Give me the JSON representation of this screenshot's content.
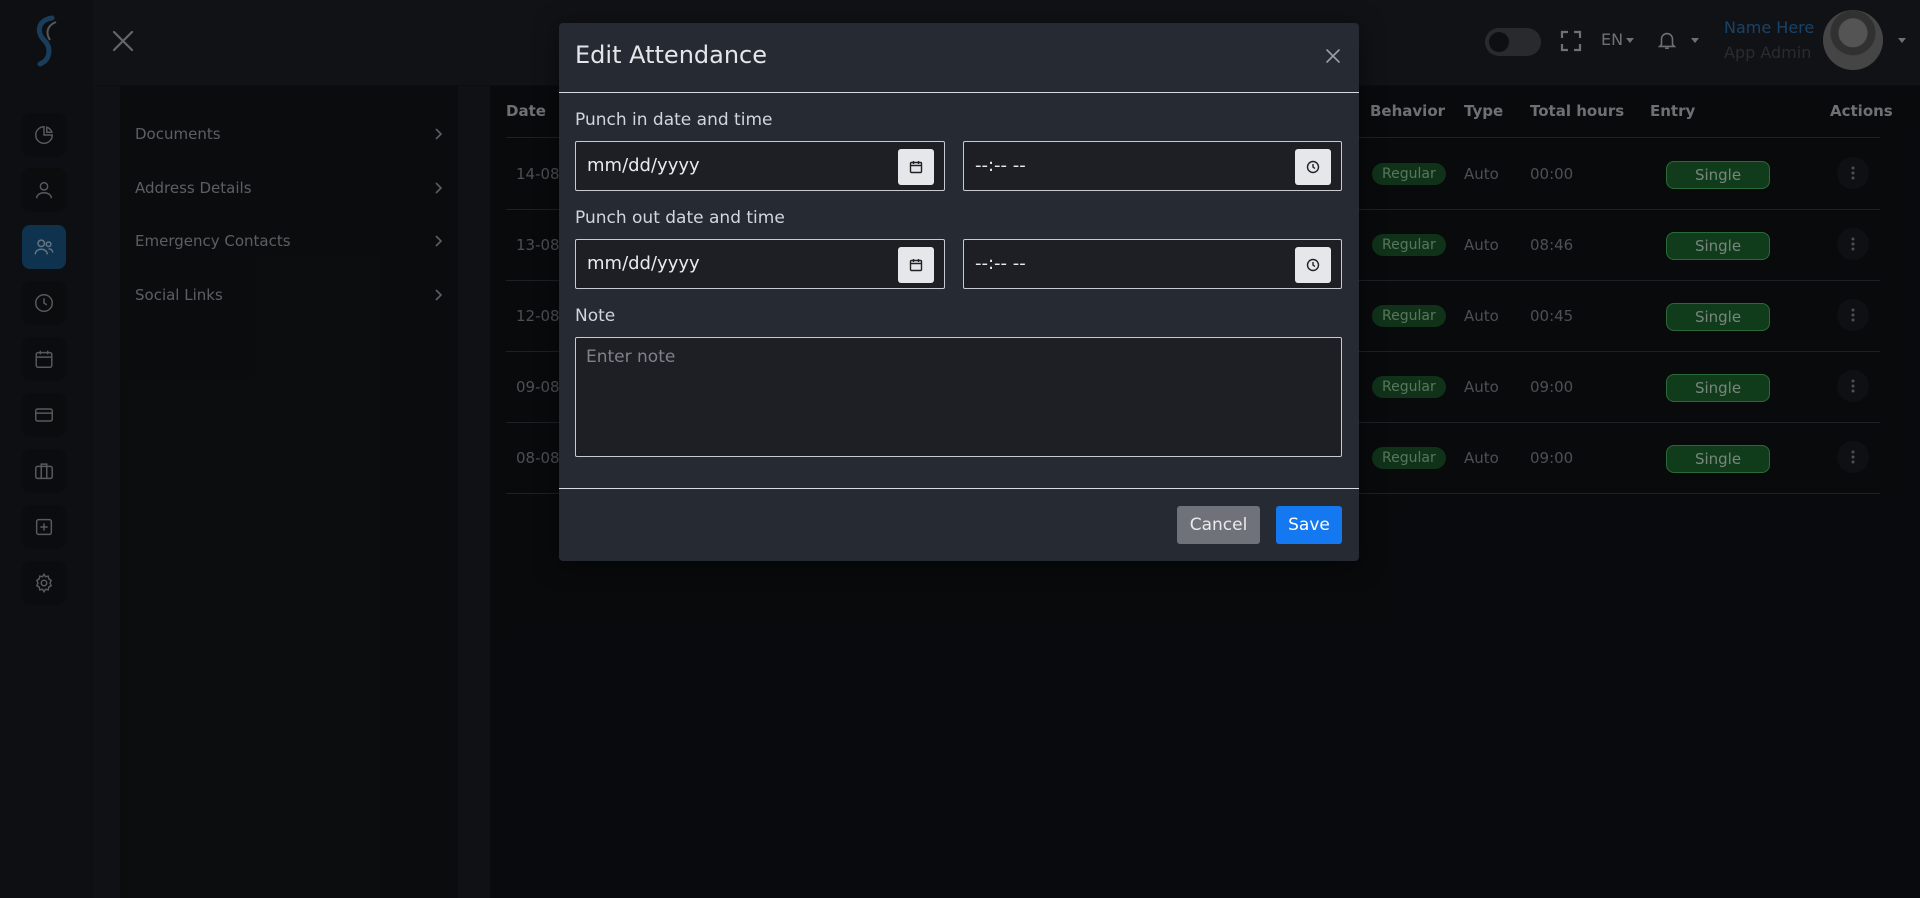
{
  "nav": {
    "icons": [
      "dashboard-pie-icon",
      "user-icon",
      "team-icon",
      "clock-icon",
      "calendar-icon",
      "card-icon",
      "briefcase-icon",
      "plus-square-icon",
      "gear-icon"
    ],
    "active_index": 2,
    "accent": "#1c5d8f"
  },
  "panel": {
    "items": [
      {
        "label": "Documents"
      },
      {
        "label": "Address Details"
      },
      {
        "label": "Emergency Contacts"
      },
      {
        "label": "Social Links"
      }
    ]
  },
  "header": {
    "language": "EN",
    "user_name": "Name Here",
    "user_role": "App Admin"
  },
  "table": {
    "columns": {
      "date": "Date",
      "behavior": "Behavior",
      "type": "Type",
      "total_hours": "Total hours",
      "entry": "Entry",
      "actions": "Actions"
    },
    "rows": [
      {
        "date": "14-08-",
        "behavior": "Regular",
        "type": "Auto",
        "total_hours": "00:00",
        "entry": "Single"
      },
      {
        "date": "13-08-",
        "behavior": "Regular",
        "type": "Auto",
        "total_hours": "08:46",
        "entry": "Single"
      },
      {
        "date": "12-08-",
        "behavior": "Regular",
        "type": "Auto",
        "total_hours": "00:45",
        "entry": "Single"
      },
      {
        "date": "09-08",
        "behavior": "Regular",
        "type": "Auto",
        "total_hours": "09:00",
        "entry": "Single"
      },
      {
        "date": "08-08",
        "behavior": "Regular",
        "type": "Auto",
        "total_hours": "09:00",
        "entry": "Single"
      }
    ]
  },
  "modal": {
    "title": "Edit Attendance",
    "punch_in_label": "Punch in date and time",
    "punch_in_date": "mm/dd/yyyy",
    "punch_in_time": "--:-- --",
    "punch_out_label": "Punch out date and time",
    "punch_out_date": "mm/dd/yyyy",
    "punch_out_time": "--:-- --",
    "note_label": "Note",
    "note_placeholder": "Enter note",
    "cancel_label": "Cancel",
    "save_label": "Save"
  },
  "colors": {
    "primary": "#1478f0",
    "success_badge": "#1f6d33",
    "user_name": "#2d7bbf"
  }
}
